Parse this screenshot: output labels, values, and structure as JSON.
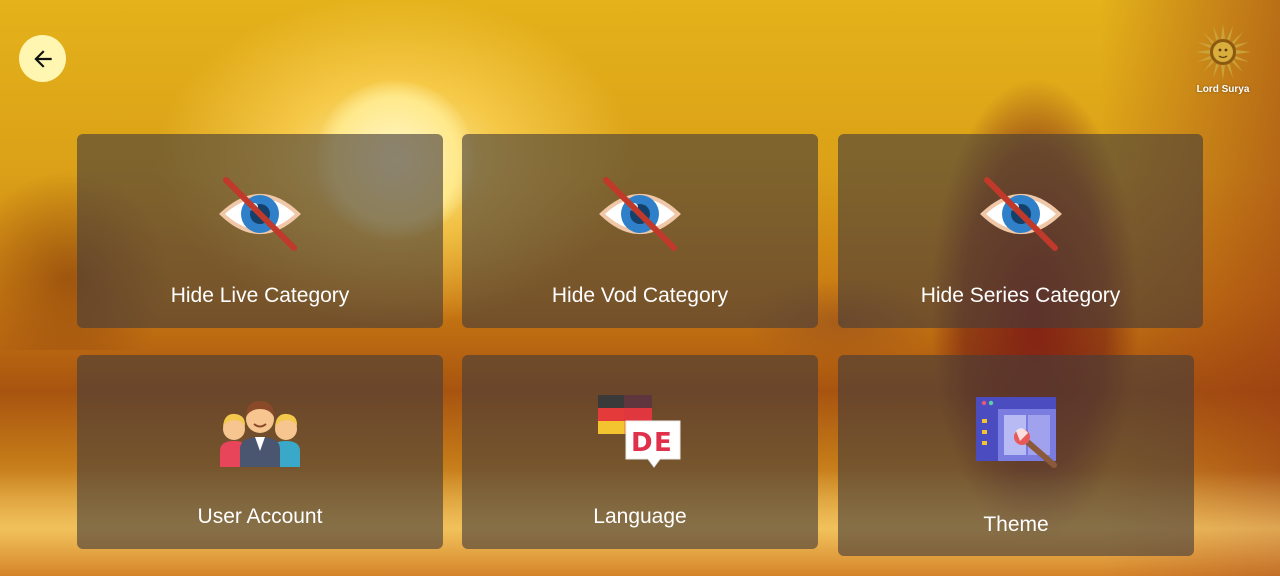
{
  "header": {
    "back_icon": "arrow-left-icon",
    "logo_icon": "sun-emblem-icon",
    "logo_text": "Lord Surya"
  },
  "tiles": [
    {
      "label": "Hide Live Category",
      "icon": "eye-slash-icon"
    },
    {
      "label": "Hide Vod Category",
      "icon": "eye-slash-icon"
    },
    {
      "label": "Hide Series Category",
      "icon": "eye-slash-icon"
    },
    {
      "label": "User Account",
      "icon": "users-group-icon"
    },
    {
      "label": "Language",
      "icon": "language-de-icon"
    },
    {
      "label": "Theme",
      "icon": "theme-palette-icon"
    }
  ],
  "colors": {
    "back_button": "#fff6b2",
    "tile_bg": "rgba(70,62,58,0.62)",
    "tile_text": "#ffffff"
  }
}
